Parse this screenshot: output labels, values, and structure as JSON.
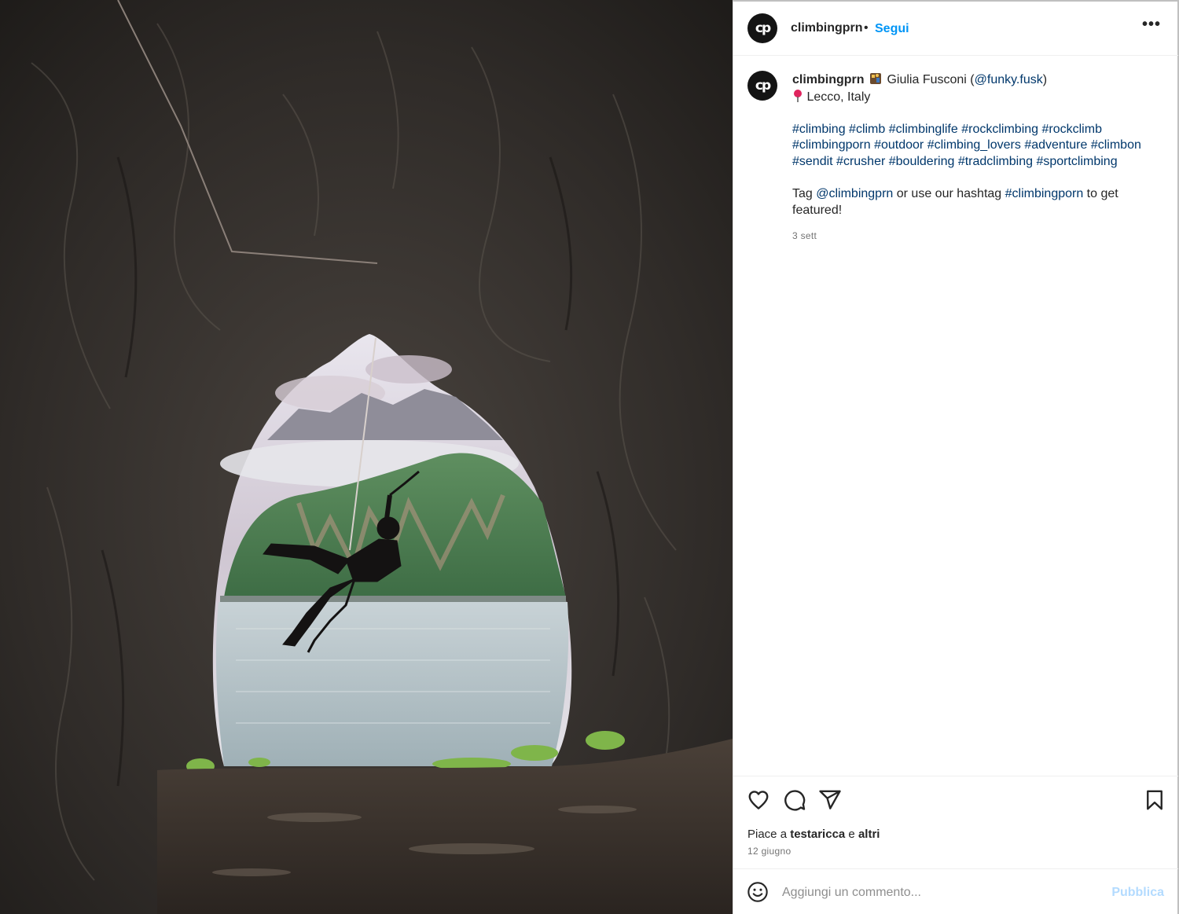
{
  "photo": {
    "alt_icon": "cave-climber-photo"
  },
  "header": {
    "username": "climbingprn",
    "separator": "•",
    "follow_label": "Segui",
    "more_icon": "more-options-icon",
    "avatar_text": "cp"
  },
  "caption": {
    "username": "climbingprn",
    "credit_name": "Giulia Fusconi (",
    "credit_handle": "@funky.fusk",
    "credit_close": ")",
    "location": "Lecco, Italy",
    "hashtags_line1": [
      "#climbing",
      "#climb",
      "#climbinglife",
      "#rockclimbing",
      "#rockclimb"
    ],
    "hashtags_line2": [
      "#climbingporn",
      "#outdoor",
      "#climbing_lovers",
      "#adventure",
      "#climbon"
    ],
    "hashtags_line3": [
      "#sendit",
      "#crusher",
      "#bouldering",
      "#tradclimbing",
      "#sportclimbing"
    ],
    "cta_prefix": "Tag ",
    "cta_mention": "@climbingprn",
    "cta_middle": " or use our hashtag ",
    "cta_hashtag": "#climbingporn",
    "cta_suffix": " to get",
    "cta_line2": "featured!",
    "time_ago": "3 sett"
  },
  "actions": {
    "likes_prefix": "Piace a ",
    "likes_user": "testaricca",
    "likes_middle": " e ",
    "likes_others": "altri",
    "date": "12 giugno"
  },
  "comment": {
    "placeholder": "Aggiungi un commento...",
    "publish_label": "Pubblica"
  },
  "colors": {
    "accent": "#0095f6",
    "link": "#00376b",
    "publish_disabled": "#b3dbff"
  }
}
